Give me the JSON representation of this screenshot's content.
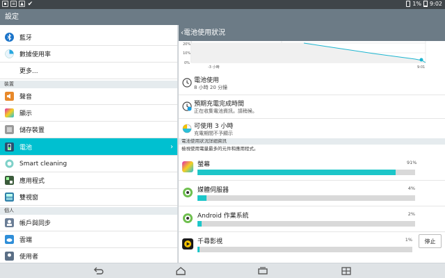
{
  "status_bar": {
    "left_icons": [
      "image-icon",
      "sd-card-icon",
      "gallery-icon",
      "check-icon"
    ],
    "battery_percent": "1%",
    "time": "9:02"
  },
  "app_title": "設定",
  "sidebar": {
    "items": [
      {
        "label": "藍牙",
        "icon": "bluetooth-icon"
      },
      {
        "label": "數據使用率",
        "icon": "data-usage-icon"
      },
      {
        "label": "更多...",
        "icon": ""
      }
    ],
    "section_device": "裝置",
    "device_items": [
      {
        "label": "聲音",
        "icon": "sound-icon"
      },
      {
        "label": "顯示",
        "icon": "display-icon"
      },
      {
        "label": "儲存裝置",
        "icon": "storage-icon"
      },
      {
        "label": "電池",
        "icon": "battery-icon",
        "selected": true
      },
      {
        "label": "Smart cleaning",
        "icon": "smart-cleaning-icon"
      },
      {
        "label": "應用程式",
        "icon": "apps-icon"
      },
      {
        "label": "雙視窗",
        "icon": "dual-window-icon"
      }
    ],
    "section_personal": "個人",
    "personal_items": [
      {
        "label": "帳戶與同步",
        "icon": "accounts-icon"
      },
      {
        "label": "雲端",
        "icon": "cloud-icon"
      },
      {
        "label": "使用者",
        "icon": "users-icon"
      }
    ]
  },
  "detail": {
    "title": "電池使用狀況",
    "chart": {
      "y_ticks": [
        "20%",
        "10%",
        "0%"
      ],
      "x_ticks": [
        "-3 小時",
        "9:01"
      ]
    },
    "usage_title": "電池使用",
    "usage_value": "8 小時 20 分鐘",
    "charge_title": "預期充電完成時間",
    "charge_value": "正在收集電池資訊。請稍候。",
    "avail_title": "可使用 3 小時",
    "avail_value": "充電期間不予顯示",
    "section_title": "電池使用狀況詳細資訊",
    "section_desc": "檢視使用電量最多的元件和應用程式。",
    "apps": [
      {
        "name": "螢幕",
        "percent": "91%",
        "value": 0.91,
        "icon": "screen-icon"
      },
      {
        "name": "媒體伺服器",
        "percent": "4%",
        "value": 0.04,
        "icon": "media-server-icon"
      },
      {
        "name": "Android 作業系統",
        "percent": "2%",
        "value": 0.02,
        "icon": "android-os-icon"
      },
      {
        "name": "千尋影視",
        "percent": "1%",
        "value": 0.01,
        "icon": "video-app-icon",
        "stop_label": "停止"
      }
    ]
  },
  "chart_data": {
    "type": "area",
    "x": [
      "-3 小時",
      "9:01"
    ],
    "y_ticks": [
      "20%",
      "10%",
      "0%"
    ],
    "note_values": [
      14,
      12,
      10,
      8,
      6,
      4,
      3,
      2,
      1
    ]
  },
  "colors": {
    "accent": "#00c0d0",
    "bar_fill": "#1dc6c9",
    "title_bar": "#6c7b86",
    "status_bar": "#3f4549"
  }
}
